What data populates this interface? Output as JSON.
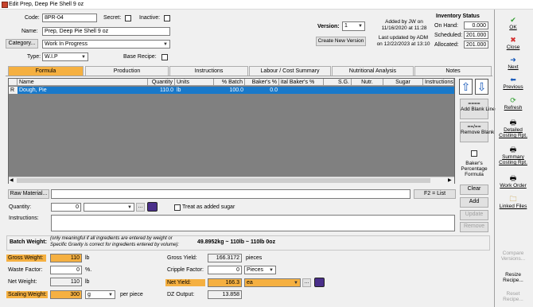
{
  "window": {
    "title": "Edit Prep, Deep Pie Shell 9 oz"
  },
  "header": {
    "code_label": "Code:",
    "code_value": "8PR-04",
    "secret_label": "Secret:",
    "inactive_label": "Inactive:",
    "name_label": "Name:",
    "name_value": "Prep, Deep Pie Shell 9 oz",
    "category_button": "Category...",
    "category_value": "Work In Progress",
    "type_label": "Type:",
    "type_value": "W.I.P",
    "base_recipe_label": "Base Recipe:",
    "version_label": "Version:",
    "version_value": "1",
    "create_version_button": "Create New Version",
    "added_by": "Added by JW on",
    "added_date": "11/16/2020 at 11:28",
    "updated_by": "Last updated by ADM",
    "updated_date": "on 12/22/2023 at 13:10"
  },
  "inventory": {
    "title": "Inventory Status",
    "on_hand_label": "On Hand:",
    "on_hand_value": "0.000",
    "scheduled_label": "Scheduled:",
    "scheduled_value": "201.000",
    "allocated_label": "Allocated:",
    "allocated_value": "201.000"
  },
  "tabs": [
    {
      "label": "Formula"
    },
    {
      "label": "Production"
    },
    {
      "label": "Instructions"
    },
    {
      "label": "Labour / Cost Summary"
    },
    {
      "label": "Nutritional Analysis"
    },
    {
      "label": "Notes"
    }
  ],
  "grid": {
    "columns": [
      "Name",
      "Quantity",
      "Units",
      "% Batch",
      "Baker's %",
      "ital Baker's %",
      "S.G.",
      "Nutr.",
      "Sugar",
      "Instructions"
    ],
    "rows": [
      {
        "marker": "R",
        "name": "Dough, Pie",
        "quantity": "110.0",
        "units": "lb",
        "batch": "100.0",
        "bakers": "0.0"
      }
    ]
  },
  "grid_side": {
    "add_blank_line": "Add Blank Line",
    "add_marker": "====",
    "remove_blank_line": "Remove Blank Line",
    "remove_marker": "==/==",
    "bakers_percentage": "Baker's Percentage Formula"
  },
  "raw_material": {
    "button": "Raw Material...",
    "f2": "F2 = List",
    "quantity_label": "Quantity:",
    "quantity_value": "0",
    "browse": "...",
    "treat_label": "Treat as added sugar",
    "instructions_label": "Instructions:",
    "clear": "Clear",
    "add": "Add",
    "update": "Update",
    "remove": "Remove"
  },
  "batch_weight": {
    "label": "Batch Weight:",
    "note1": "(only meaningful if all ingredients are entered by weight or",
    "note2": "Specific Gravity is correct for ingredients entered by volume):",
    "value": "49.8952kg  ~  110lb  ~  110lb 0oz"
  },
  "bottom_left": {
    "gross_weight_label": "Gross Weight:",
    "gross_weight_value": "110",
    "gross_weight_unit": "lb",
    "waste_factor_label": "Waste Factor:",
    "waste_factor_value": "0",
    "waste_factor_unit": "%.",
    "net_weight_label": "Net Weight:",
    "net_weight_value": "110",
    "net_weight_unit": "lb",
    "scaling_weight_label": "Scaling Weight:",
    "scaling_weight_value": "300",
    "scaling_unit": "g",
    "per_piece": "per piece"
  },
  "bottom_right": {
    "gross_yield_label": "Gross Yield:",
    "gross_yield_value": "166.3172",
    "gross_yield_unit": "pieces",
    "cripple_factor_label": "Cripple Factor:",
    "cripple_factor_value": "0",
    "cripple_unit": "Pieces",
    "net_yield_label": "Net Yield:",
    "net_yield_value": "166.3",
    "net_yield_unit": "ea",
    "dz_output_label": "DZ Output:",
    "dz_output_value": "13.858",
    "browse": "..."
  },
  "right_panel": {
    "ok": "OK",
    "close": "Close",
    "next": "Next",
    "previous": "Previous",
    "refresh": "Refresh",
    "detailed": "Detailed Costing Rpt.",
    "summary": "Summary Costing Rpt.",
    "work_order": "Work Order",
    "linked_files": "Linked Files",
    "compare_versions": "Compare Versions...",
    "resize_recipe": "Resize Recipe...",
    "reset_recipe": "Reset Recipe..."
  },
  "colors": {
    "accent": "#f5b041",
    "selection": "#1979ca",
    "grid_bg": "#808080"
  }
}
